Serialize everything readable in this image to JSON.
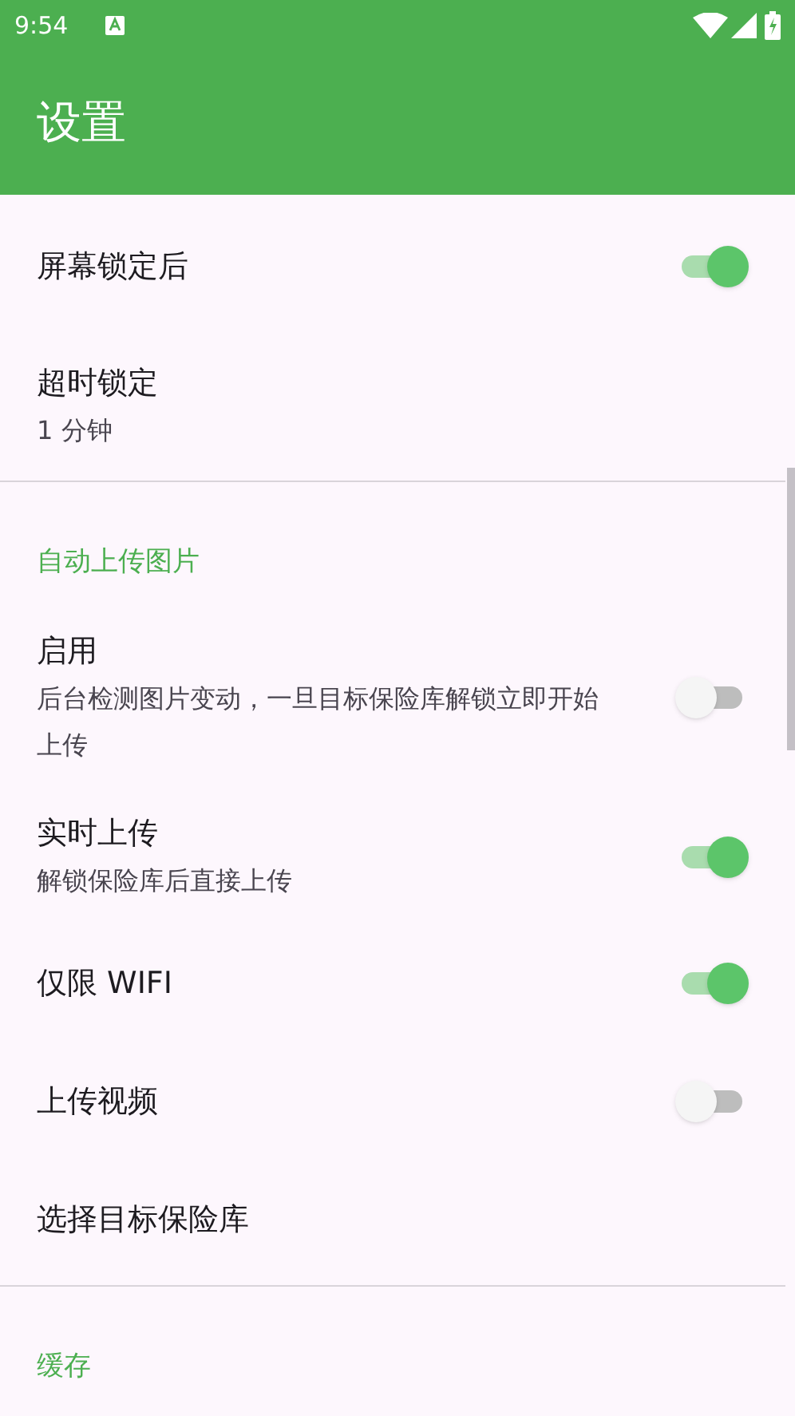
{
  "status_bar": {
    "time": "9:54"
  },
  "app_bar": {
    "title": "设置"
  },
  "items": [
    {
      "kind": "switch",
      "title": "屏幕锁定后",
      "on": true
    },
    {
      "kind": "text",
      "title": "超时锁定",
      "summary": "1 分钟"
    },
    {
      "kind": "divider"
    },
    {
      "kind": "header",
      "title": "自动上传图片"
    },
    {
      "kind": "switch",
      "title": "启用",
      "summary": "后台检测图片变动，一旦目标保险库解锁立即开始上传",
      "on": false
    },
    {
      "kind": "switch",
      "title": "实时上传",
      "summary": "解锁保险库后直接上传",
      "on": true
    },
    {
      "kind": "switch",
      "title": "仅限 WIFI",
      "on": true
    },
    {
      "kind": "switch",
      "title": "上传视频",
      "on": false
    },
    {
      "kind": "text",
      "title": "选择目标保险库"
    },
    {
      "kind": "divider"
    },
    {
      "kind": "header",
      "title": "缓存"
    }
  ]
}
